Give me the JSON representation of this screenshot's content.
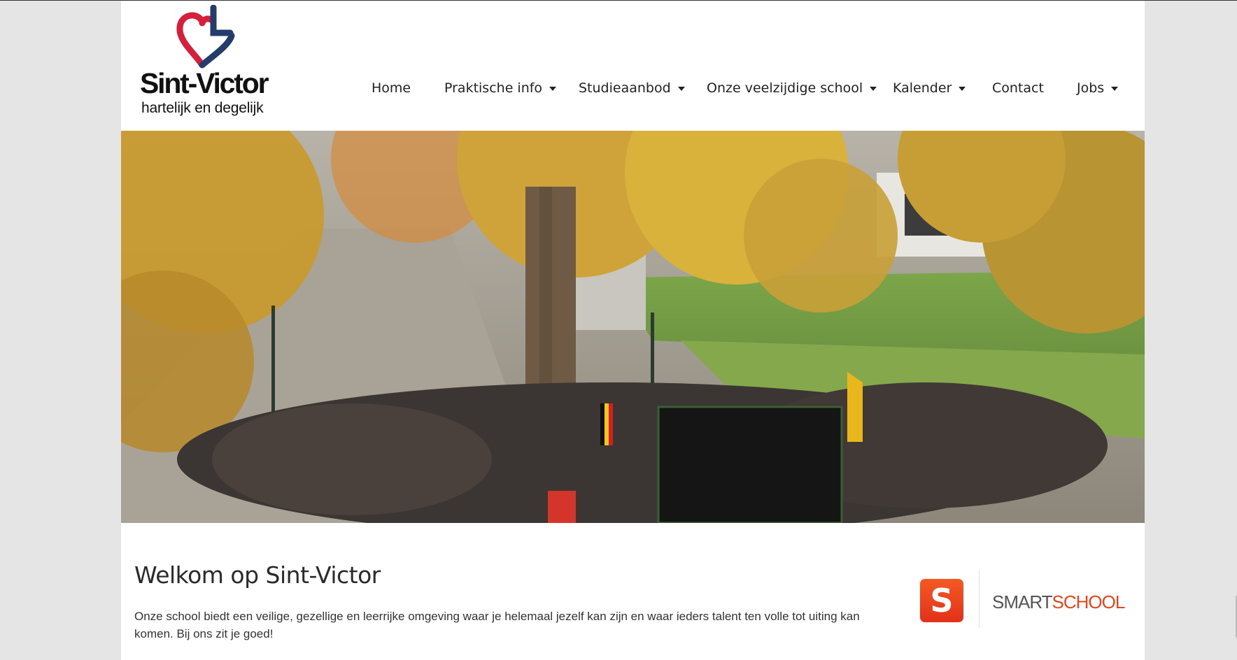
{
  "site": {
    "logo_name": "Sint-Victor",
    "logo_tagline": "hartelijk en degelijk",
    "logo_colors": {
      "heart": "#d61f3b",
      "mark": "#233c6a"
    }
  },
  "nav": {
    "items": [
      {
        "label": "Home",
        "dropdown": false
      },
      {
        "label": "Praktische info",
        "dropdown": true
      },
      {
        "label": "Studieaanbod",
        "dropdown": true
      },
      {
        "label": "Onze veelzijdige school",
        "dropdown": true
      },
      {
        "label": "Kalender",
        "dropdown": true
      },
      {
        "label": "Contact",
        "dropdown": false
      },
      {
        "label": "Jobs",
        "dropdown": true
      }
    ]
  },
  "hero": {
    "icon": "hero-photo",
    "description_icon": "school-gathering-photo"
  },
  "main": {
    "title": "Welkom op Sint-Victor",
    "intro": "Onze school biedt een veilige, gezellige en leerrijke omgeving waar je helemaal jezelf kan zijn en waar ieders talent ten volle tot uiting kan komen. Bij ons zit je goed!"
  },
  "smartschool": {
    "icon_letter": "S",
    "word_part1": "SMART",
    "word_part2": "SCHOOL",
    "accent_color": "#e6461d"
  }
}
